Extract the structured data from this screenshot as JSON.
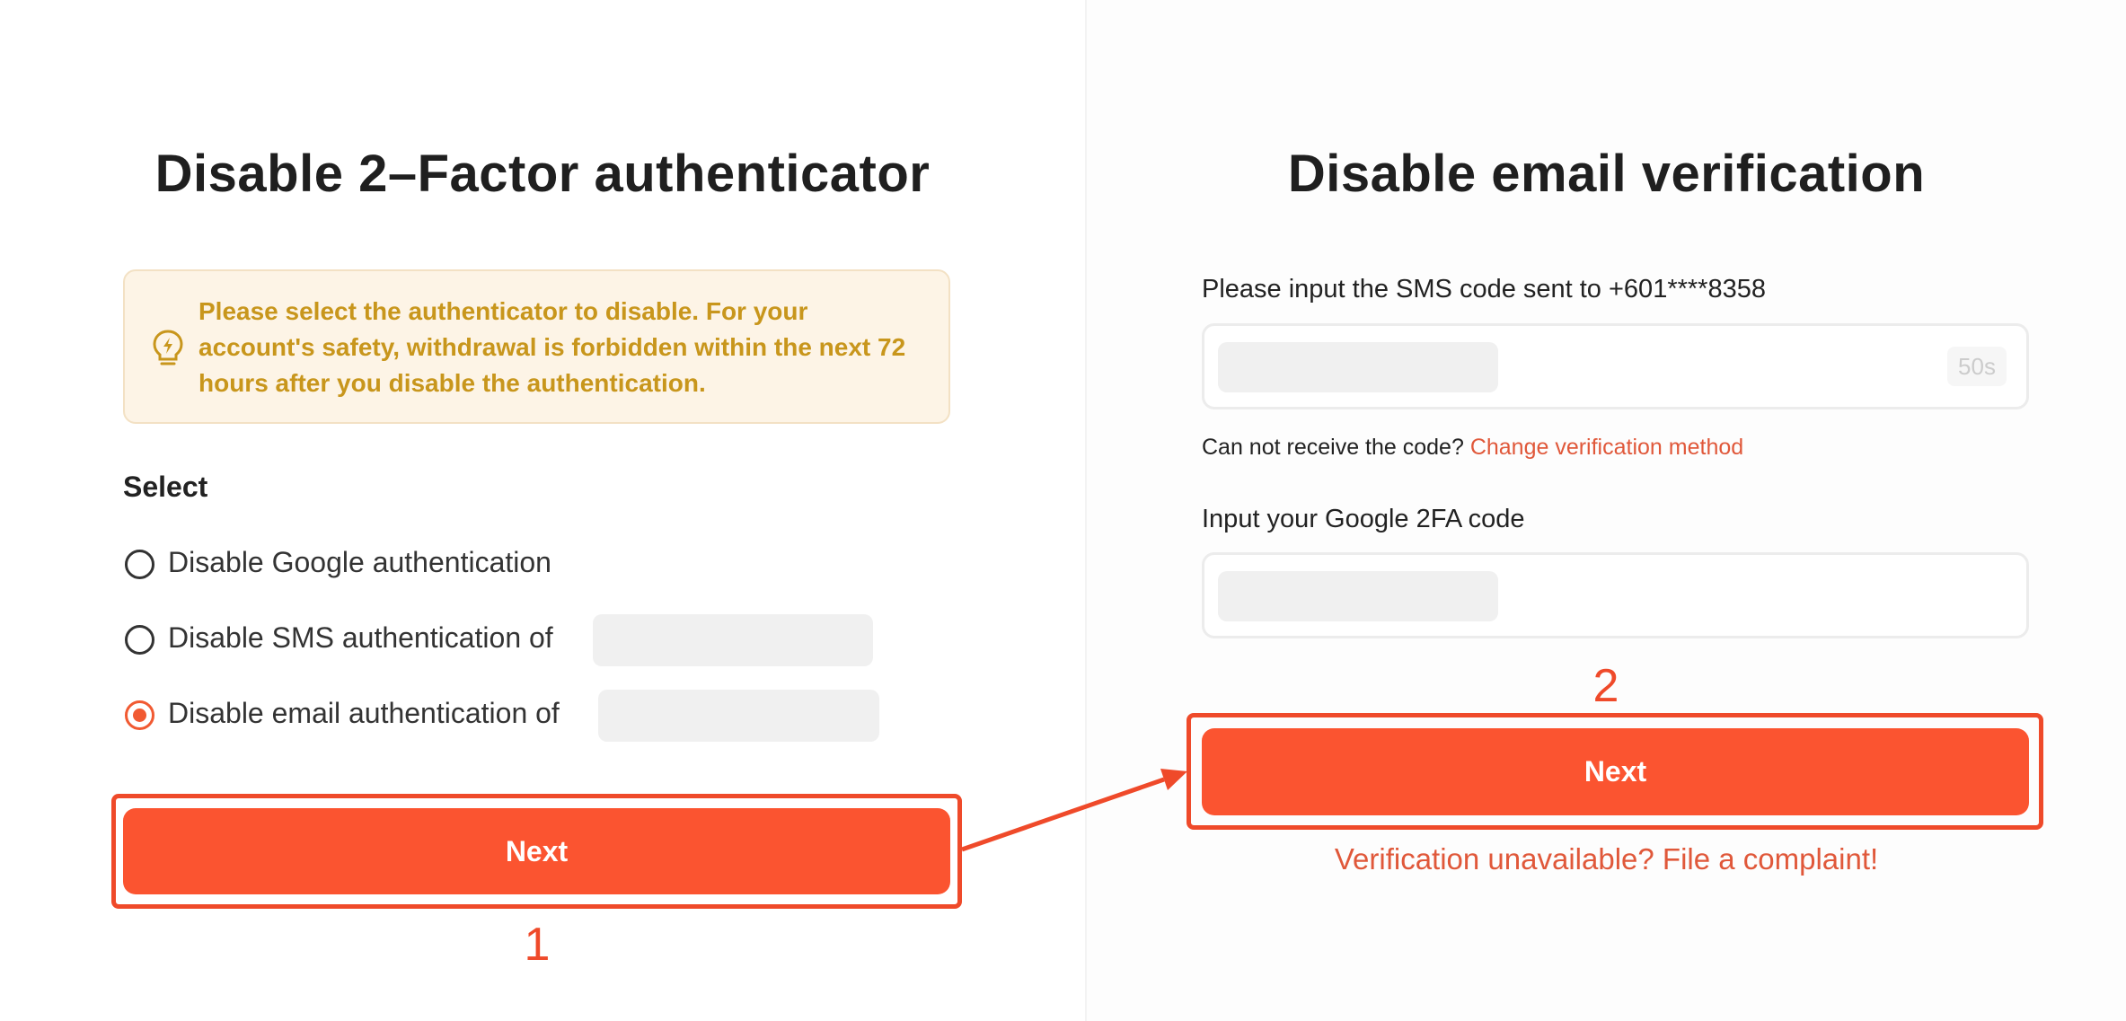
{
  "left": {
    "title": "Disable 2–Factor authenticator",
    "notice": {
      "icon": "lightbulb-icon",
      "text": "Please select the authenticator to disable. For your account's safety, withdrawal is forbidden within the next 72 hours after you disable the authentication."
    },
    "select_label": "Select",
    "options": [
      {
        "label": "Disable Google authentication",
        "checked": false
      },
      {
        "label": "Disable SMS authentication of",
        "checked": false
      },
      {
        "label": "Disable email authentication of",
        "checked": true
      }
    ],
    "next_label": "Next",
    "step_number": "1"
  },
  "right": {
    "title": "Disable email verification",
    "sms_label": "Please input the SMS code sent to +601****8358",
    "sms_countdown": "50s",
    "cannot_receive_text": "Can not receive the code?",
    "change_method_link": "Change verification method",
    "google_label": "Input your Google 2FA code",
    "next_label": "Next",
    "step_number": "2",
    "complaint_link": "Verification unavailable? File a complaint!"
  },
  "colors": {
    "accent": "#fb5430",
    "annotation": "#ef4a2a",
    "notice_text": "#c8961c",
    "notice_bg": "#fdf4e6",
    "link": "#e0583a"
  }
}
